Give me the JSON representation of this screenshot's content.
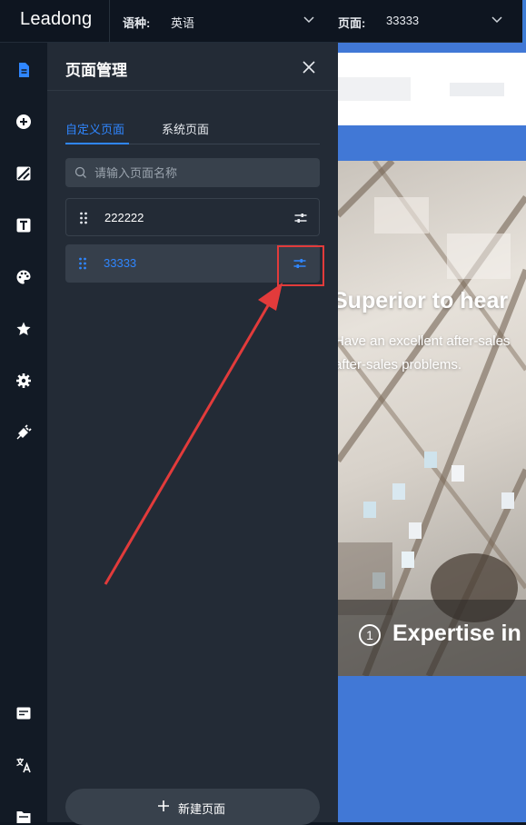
{
  "topbar": {
    "logo": "Leadong",
    "language_label": "语种:",
    "language_value": "英语",
    "page_label": "页面:",
    "page_value": "33333"
  },
  "rail": {
    "icons": [
      "page-icon",
      "add-circle-icon",
      "image-icon",
      "text-icon",
      "palette-icon",
      "star-icon",
      "gear-icon",
      "plugin-icon",
      "form-icon",
      "translate-icon",
      "folder-icon"
    ]
  },
  "panel": {
    "title": "页面管理",
    "tabs": [
      {
        "label": "自定义页面",
        "active": true
      },
      {
        "label": "系统页面",
        "active": false
      }
    ],
    "search_placeholder": "请输入页面名称",
    "pages": [
      {
        "name": "222222",
        "selected": false
      },
      {
        "name": "33333",
        "selected": true
      }
    ],
    "new_page_label": "新建页面"
  },
  "preview": {
    "hero_title": "Superior to hear",
    "hero_line1": "Have an excellent after-sales",
    "hero_line2": "after-sales problems.",
    "step_number": "1",
    "step_text": "Expertise in"
  },
  "colors": {
    "accent": "#2f86ff",
    "highlight": "#e23b3b",
    "preview_blue": "#4178d6"
  }
}
